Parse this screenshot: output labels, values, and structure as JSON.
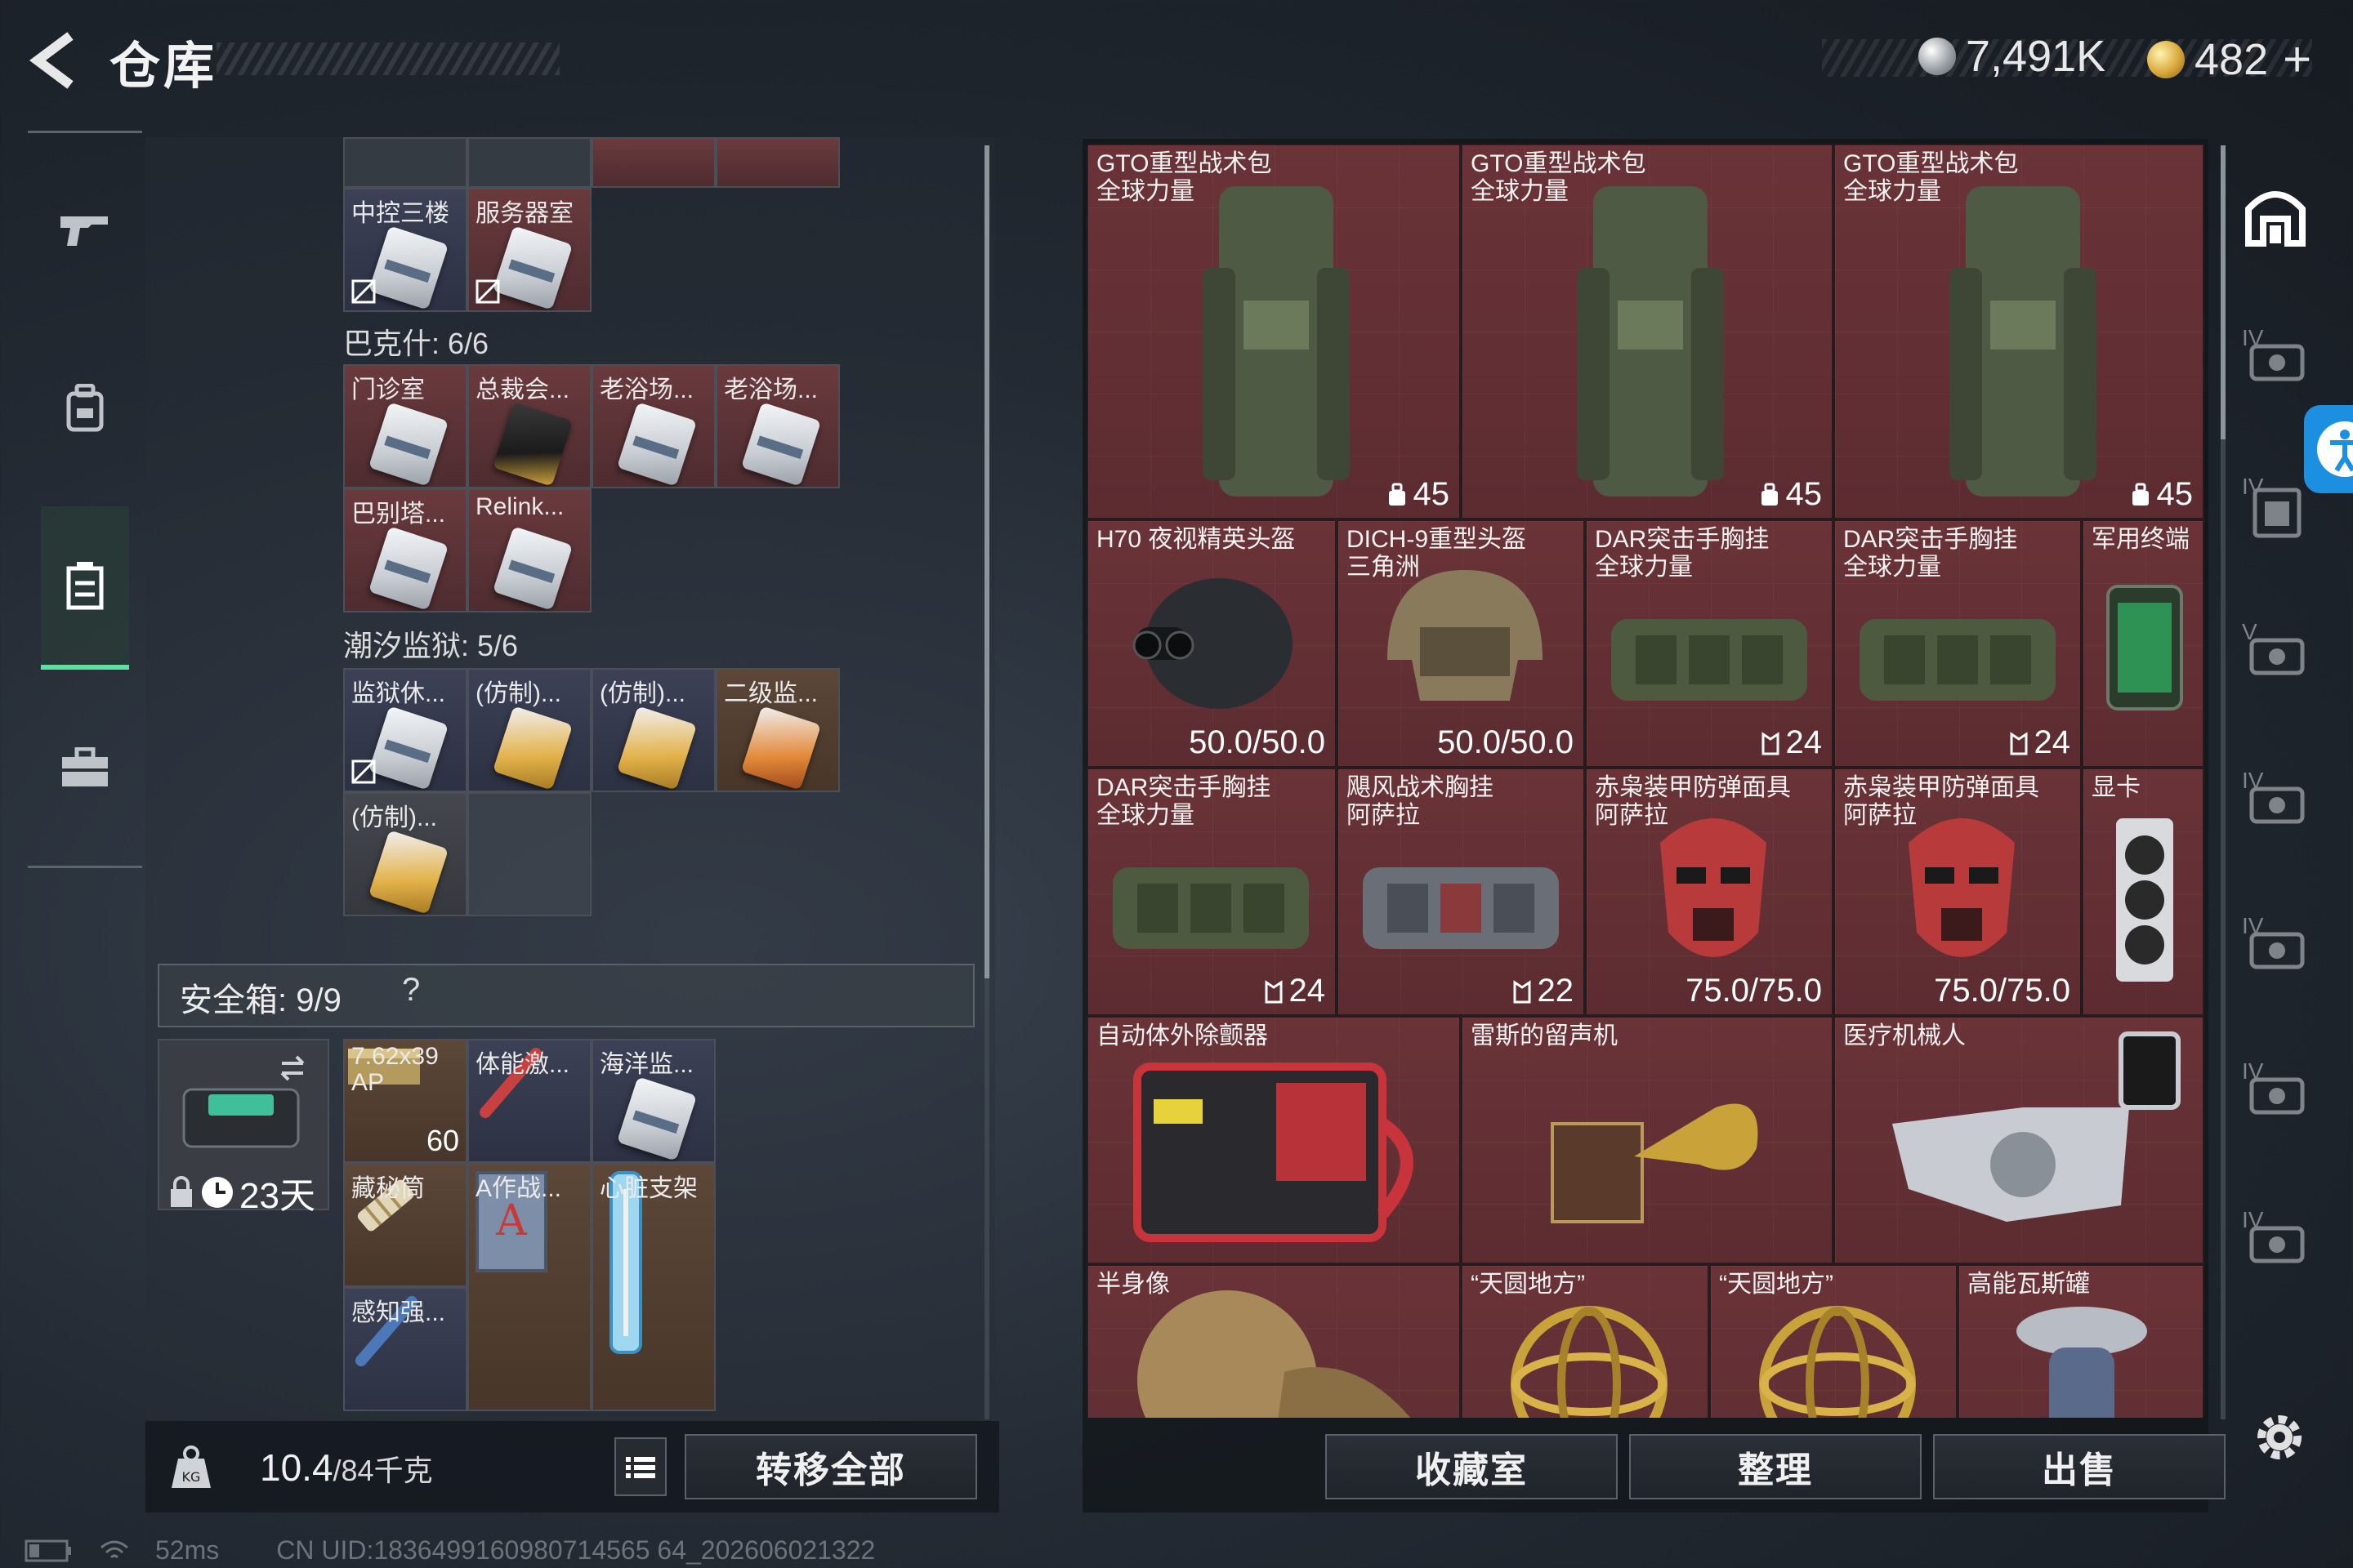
{
  "header": {
    "title": "仓库",
    "currency_silver": "7,491K",
    "currency_gold": "482",
    "plus_label": "+"
  },
  "warehouse": {
    "top_row": [
      {
        "label": "中控三楼",
        "color": "blue"
      },
      {
        "label": "服务器室",
        "color": "red"
      }
    ],
    "groups": [
      {
        "title": "巴克什: 6/6",
        "items": [
          {
            "label": "门诊室",
            "color": "red",
            "card": "white"
          },
          {
            "label": "总裁会...",
            "color": "red",
            "card": "gold"
          },
          {
            "label": "老浴场...",
            "color": "red",
            "card": "white"
          },
          {
            "label": "老浴场...",
            "color": "red",
            "card": "white"
          },
          {
            "label": "巴别塔...",
            "color": "red",
            "card": "white"
          },
          {
            "label": "Relink...",
            "color": "red",
            "card": "white"
          }
        ]
      },
      {
        "title": "潮汐监狱: 5/6",
        "items": [
          {
            "label": "监狱休...",
            "color": "blue",
            "card": "white"
          },
          {
            "label": "(仿制)...",
            "color": "blue",
            "card": "amber"
          },
          {
            "label": "(仿制)...",
            "color": "blue",
            "card": "amber"
          },
          {
            "label": "二级监...",
            "color": "brown",
            "card": "orange"
          },
          {
            "label": "(仿制)...",
            "color": "gray",
            "card": "amber"
          }
        ]
      }
    ]
  },
  "safebox": {
    "label": "安全箱: 9/9",
    "help": "?",
    "days": "23天",
    "items": [
      {
        "label": "7.62x39 AP",
        "qty": "60",
        "color": "brown"
      },
      {
        "label": "体能激...",
        "color": "blue"
      },
      {
        "label": "海洋监...",
        "color": "blue"
      },
      {
        "label": "藏秘筒",
        "color": "brown"
      },
      {
        "label": "A作战...",
        "color": "brown"
      },
      {
        "label": "心脏支架",
        "color": "brown"
      },
      {
        "label": "感知强...",
        "color": "blue"
      }
    ]
  },
  "footer_left": {
    "weight_current": "10.4",
    "weight_total": "/84千克",
    "transfer_all": "转移全部"
  },
  "stash": {
    "backpacks": [
      {
        "name": "GTO重型战术包\n全球力量",
        "stat": "45"
      },
      {
        "name": "GTO重型战术包\n全球力量",
        "stat": "45"
      },
      {
        "name": "GTO重型战术包\n全球力量",
        "stat": "45"
      }
    ],
    "row2": [
      {
        "name": "H70 夜视精英头盔",
        "stat": "50.0/50.0"
      },
      {
        "name": "DICH-9重型头盔\n三角洲",
        "stat": "50.0/50.0"
      },
      {
        "name": "DAR突击手胸挂\n全球力量",
        "stat": "24"
      },
      {
        "name": "DAR突击手胸挂\n全球力量",
        "stat": "24"
      },
      {
        "name": "军用终端",
        "stat": ""
      }
    ],
    "row3": [
      {
        "name": "DAR突击手胸挂\n全球力量",
        "stat": "24"
      },
      {
        "name": "飓风战术胸挂\n阿萨拉",
        "stat": "22"
      },
      {
        "name": "赤枭装甲防弹面具\n阿萨拉",
        "stat": "75.0/75.0"
      },
      {
        "name": "赤枭装甲防弹面具\n阿萨拉",
        "stat": "75.0/75.0"
      },
      {
        "name": "显卡",
        "stat": ""
      }
    ],
    "row4": [
      {
        "name": "自动体外除颤器"
      },
      {
        "name": "雷斯的留声机"
      },
      {
        "name": "医疗机械人"
      }
    ],
    "row5": [
      {
        "name": "半身像"
      },
      {
        "name": "“天圆地方”"
      },
      {
        "name": "“天圆地方”"
      },
      {
        "name": "高能瓦斯罐"
      }
    ]
  },
  "footer_right": {
    "collection": "收藏室",
    "sort": "整理",
    "sell": "出售"
  },
  "tiers": [
    "IV",
    "IV",
    "V",
    "IV",
    "IV",
    "IV",
    "IV"
  ],
  "status": {
    "ping": "52ms",
    "uid": "CN UID:1836499160980714565 64_202606021322"
  },
  "colors": {
    "accent_green": "#5fe0a0",
    "rarity_red": "#6a3338",
    "rarity_blue": "#3c4156",
    "rarity_brown": "#5c4738",
    "accessibility_blue": "#1d8fe0"
  }
}
